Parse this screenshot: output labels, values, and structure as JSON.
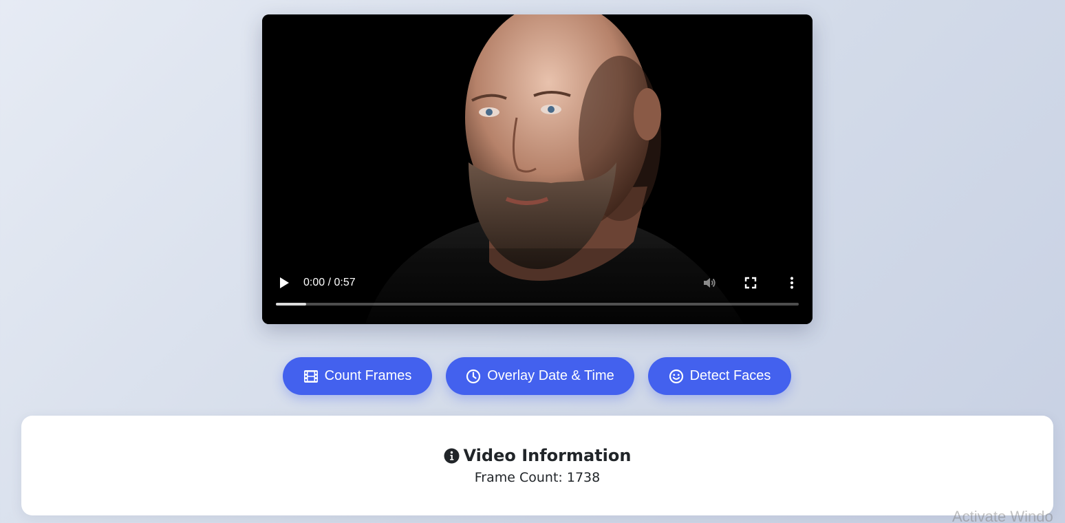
{
  "video": {
    "time_display": "0:00 / 0:57",
    "progress_fraction": 0.058,
    "icons": {
      "play": "play-icon",
      "volume": "volume-icon",
      "fullscreen": "fullscreen-icon",
      "more": "more-options-icon"
    }
  },
  "actions": [
    {
      "label": "Count Frames",
      "icon": "film-icon"
    },
    {
      "label": "Overlay Date & Time",
      "icon": "clock-icon"
    },
    {
      "label": "Detect Faces",
      "icon": "smile-icon"
    }
  ],
  "info": {
    "title": "Video Information",
    "title_icon": "info-circle-icon",
    "frame_count_text": "Frame Count: 1738"
  },
  "watermark": "Activate Windo",
  "colors": {
    "accent": "#4361ee",
    "card_bg": "#ffffff",
    "text_dark": "#212529"
  }
}
